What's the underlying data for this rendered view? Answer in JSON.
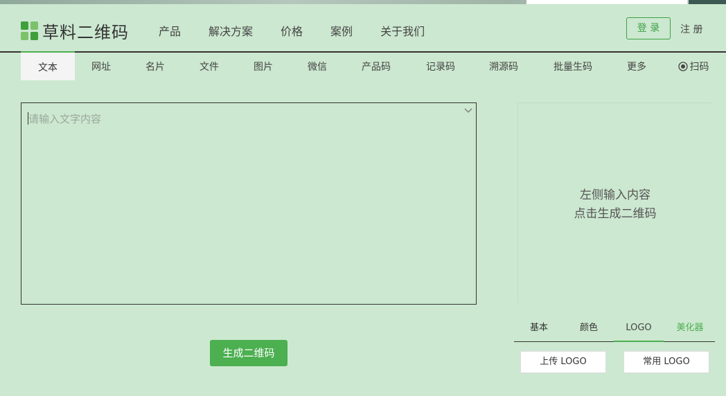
{
  "header": {
    "logo_text": "草料二维码",
    "nav": [
      "产品",
      "解决方案",
      "价格",
      "案例",
      "关于我们"
    ],
    "login_label": "登 录",
    "register_label": "注 册"
  },
  "tabs": [
    {
      "label": "文本",
      "active": true
    },
    {
      "label": "网址"
    },
    {
      "label": "名片"
    },
    {
      "label": "文件"
    },
    {
      "label": "图片"
    },
    {
      "label": "微信"
    },
    {
      "label": "产品码"
    },
    {
      "label": "记录码"
    },
    {
      "label": "溯源码"
    },
    {
      "label": "批量生码"
    },
    {
      "label": "更多"
    },
    {
      "label": "扫码",
      "icon": "camera-icon"
    }
  ],
  "editor": {
    "placeholder": "请输入文字内容",
    "value": ""
  },
  "generate_label": "生成二维码",
  "preview": {
    "line1": "左侧输入内容",
    "line2": "点击生成二维码"
  },
  "style_tabs": [
    "基本",
    "颜色",
    "LOGO",
    "美化器"
  ],
  "logo_buttons": {
    "upload": "上传 LOGO",
    "common": "常用 LOGO"
  },
  "colors": {
    "background": "#cce8d0",
    "accent": "#4caf50"
  }
}
